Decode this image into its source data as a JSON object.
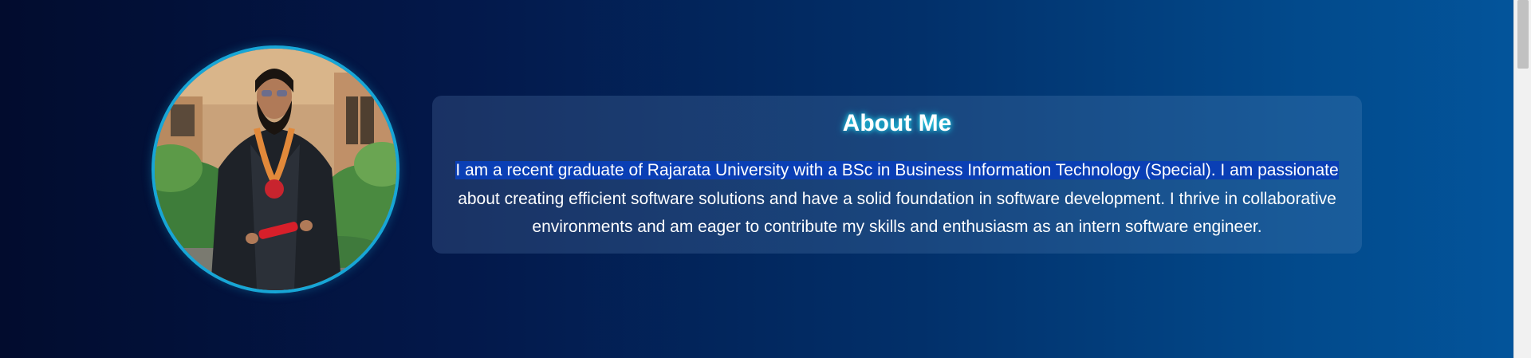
{
  "about": {
    "title": "About Me",
    "highlighted_text": "I am a recent graduate of Rajarata University with a BSc in Business Information Technology (Special). I am passionate",
    "body_text": " about creating efficient software solutions and have a solid foundation in software development. I thrive in collaborative environments and am eager to contribute my skills and enthusiasm as an intern software engineer."
  },
  "portrait": {
    "icon": "graduate-portrait-photo",
    "border_color": "#17a6d6"
  },
  "colors": {
    "background_start": "#020c2e",
    "background_end": "#03559c",
    "title_glow": "#22d0e8",
    "selection": "#0a3fb5"
  }
}
